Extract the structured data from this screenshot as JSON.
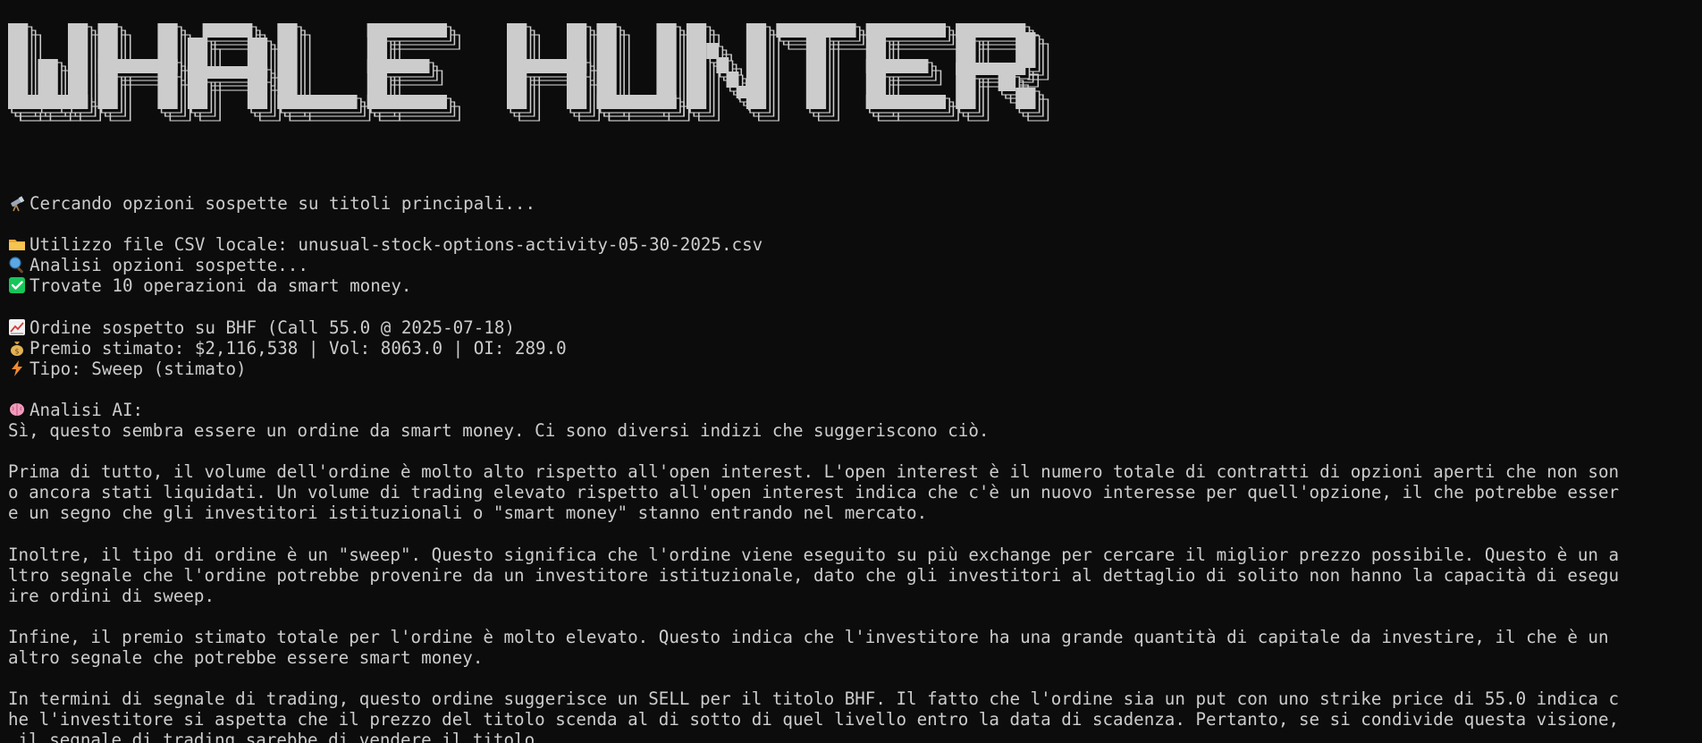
{
  "banner": {
    "title": "WHALE HUNTER"
  },
  "colors": {
    "background": "#0c0c0c",
    "text": "#cccccc",
    "banner_fill": "#cccccc"
  },
  "lines": [
    {
      "icon": "telescope-icon",
      "text": "Cercando opzioni sospette su titoli principali..."
    },
    {
      "icon": "",
      "text": ""
    },
    {
      "icon": "folder-icon",
      "text": "Utilizzo file CSV locale: unusual-stock-options-activity-05-30-2025.csv"
    },
    {
      "icon": "magnifier-icon",
      "text": "Analisi opzioni sospette..."
    },
    {
      "icon": "check-icon",
      "text": "Trovate 10 operazioni da smart money."
    },
    {
      "icon": "",
      "text": ""
    },
    {
      "icon": "chart-up-icon",
      "text": "Ordine sospetto su BHF (Call 55.0 @ 2025-07-18)"
    },
    {
      "icon": "money-bag-icon",
      "text": "Premio stimato: $2,116,538 | Vol: 8063.0 | OI: 289.0"
    },
    {
      "icon": "lightning-icon",
      "text": "Tipo: Sweep (stimato)"
    },
    {
      "icon": "",
      "text": ""
    },
    {
      "icon": "brain-icon",
      "text": "Analisi AI:"
    },
    {
      "icon": "",
      "text": "Sì, questo sembra essere un ordine da smart money. Ci sono diversi indizi che suggeriscono ciò."
    },
    {
      "icon": "",
      "text": ""
    },
    {
      "icon": "",
      "text": "Prima di tutto, il volume dell'ordine è molto alto rispetto all'open interest. L'open interest è il numero totale di contratti di opzioni aperti che non son"
    },
    {
      "icon": "",
      "text": "o ancora stati liquidati. Un volume di trading elevato rispetto all'open interest indica che c'è un nuovo interesse per quell'opzione, il che potrebbe esser"
    },
    {
      "icon": "",
      "text": "e un segno che gli investitori istituzionali o \"smart money\" stanno entrando nel mercato."
    },
    {
      "icon": "",
      "text": ""
    },
    {
      "icon": "",
      "text": "Inoltre, il tipo di ordine è un \"sweep\". Questo significa che l'ordine viene eseguito su più exchange per cercare il miglior prezzo possibile. Questo è un a"
    },
    {
      "icon": "",
      "text": "ltro segnale che l'ordine potrebbe provenire da un investitore istituzionale, dato che gli investitori al dettaglio di solito non hanno la capacità di esegu"
    },
    {
      "icon": "",
      "text": "ire ordini di sweep."
    },
    {
      "icon": "",
      "text": ""
    },
    {
      "icon": "",
      "text": "Infine, il premio stimato totale per l'ordine è molto elevato. Questo indica che l'investitore ha una grande quantità di capitale da investire, il che è un"
    },
    {
      "icon": "",
      "text": "altro segnale che potrebbe essere smart money."
    },
    {
      "icon": "",
      "text": ""
    },
    {
      "icon": "",
      "text": "In termini di segnale di trading, questo ordine suggerisce un SELL per il titolo BHF. Il fatto che l'ordine sia un put con uno strike price di 55.0 indica c"
    },
    {
      "icon": "",
      "text": "he l'investitore si aspetta che il prezzo del titolo scenda al di sotto di quel livello entro la data di scadenza. Pertanto, se si condivide questa visione,"
    },
    {
      "icon": "",
      "text": " il segnale di trading sarebbe di vendere il titolo."
    },
    {
      "icon": "",
      "text": "--------------------------------------------------"
    }
  ]
}
